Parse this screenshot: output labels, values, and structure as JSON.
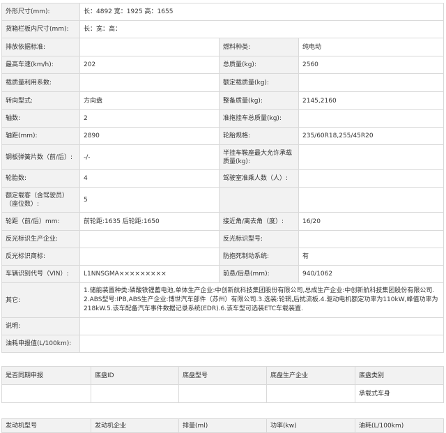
{
  "spec_rows": [
    {
      "type": "wide",
      "label": "外形尺寸(mm):",
      "value": "长：4892 宽：1925 高：1655",
      "height": 25
    },
    {
      "type": "wide",
      "label": "货箱栏板内尺寸(mm):",
      "value": "长：宽：高：",
      "height": 25
    },
    {
      "type": "pair",
      "l1": "排放依据标准:",
      "v1": "",
      "l2": "燃料种类:",
      "v2": "纯电动",
      "height": 26
    },
    {
      "type": "pair",
      "l1": "最高车速(km/h):",
      "v1": "202",
      "l2": "总质量(kg):",
      "v2": "2560",
      "height": 25
    },
    {
      "type": "pair",
      "l1": "载质量利用系数:",
      "v1": "",
      "l2": "额定载质量(kg):",
      "v2": "",
      "height": 26
    },
    {
      "type": "pair",
      "l1": "转向型式:",
      "v1": "方向盘",
      "l2": "整备质量(kg):",
      "v2": "2145,2160",
      "height": 26
    },
    {
      "type": "pair",
      "l1": "轴数:",
      "v1": "2",
      "l2": "准拖挂车总质量(kg):",
      "v2": "",
      "height": 25
    },
    {
      "type": "pair",
      "l1": "轴距(mm):",
      "v1": "2890",
      "l2": "轮胎规格:",
      "v2": "235/60R18,255/45R20",
      "height": 25
    },
    {
      "type": "pair",
      "l1": "钢板弹簧片数（前/后）:",
      "v1": "-/-",
      "l2": "半挂车鞍座最大允许承载质量(kg):",
      "v2": "",
      "height": 36
    },
    {
      "type": "pair",
      "l1": "轮胎数:",
      "v1": "4",
      "l2": "驾驶室准乘人数（人）:",
      "v2": "",
      "height": 25
    },
    {
      "type": "pair",
      "l1": "额定载客（含驾驶员）（座位数）:",
      "v1": "5",
      "l2": "",
      "v2": "",
      "height": 36
    },
    {
      "type": "pair",
      "l1": "轮距（前/后）mm:",
      "v1": "前轮距:1635 后轮距:1650",
      "l2": "接近角/离去角（度）:",
      "v2": "16/20",
      "height": 26
    },
    {
      "type": "pair",
      "l1": "反光标识生产企业:",
      "v1": "",
      "l2": "反光标识型号:",
      "v2": "",
      "height": 25
    },
    {
      "type": "pair",
      "l1": "反光标识商标:",
      "v1": "",
      "l2": "防抱死制动系统:",
      "v2": "有",
      "height": 25
    },
    {
      "type": "pair",
      "l1": "车辆识别代号（VIN）:",
      "v1": "L1NNSGMA×××××××××",
      "l2": "前悬/后悬(mm):",
      "v2": "940/1062",
      "height": 25
    },
    {
      "type": "long",
      "label": "其它:",
      "value": "1.储能装置种类:磷酸铁锂蓄电池,单体生产企业:中创新航科技集团股份有限公司,总成生产企业:中创新航科技集团股份有限公司.2.ABS型号:IPB,ABS生产企业:博世汽车部件（苏州）有限公司.3.选装:轮辋,后扰流板.4.驱动电机额定功率为110kW,峰值功率为218kW.5.该车配备汽车事件数据记录系统(EDR).6.该车型可选装ETC车载装置.",
      "height": 50
    },
    {
      "type": "wide",
      "label": "说明:",
      "value": "",
      "height": 25
    },
    {
      "type": "wide",
      "label": "油耗申报值(L/100km):",
      "value": "",
      "height": 25
    }
  ],
  "chassis_table": {
    "headers": [
      "是否同期申报",
      "底盘ID",
      "底盘型号",
      "底盘生产企业",
      "底盘类别"
    ],
    "row": [
      "",
      "",
      "",
      "",
      "承载式车身"
    ]
  },
  "engine_table": {
    "headers": [
      "发动机型号",
      "发动机企业",
      "排量(ml)",
      "功率(kw)",
      "油耗(L/100km)"
    ]
  }
}
